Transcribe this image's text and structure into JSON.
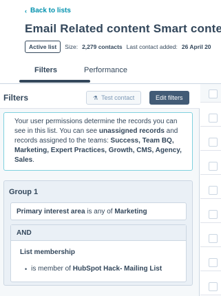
{
  "header": {
    "back_label": "Back to lists",
    "title": "Email Related content Smart content-",
    "badge": "Active list",
    "size_label": "Size:",
    "size_value": "2,279 contacts",
    "last_added_label": "Last contact added:",
    "last_added_value": "26 April 20"
  },
  "tabs": [
    {
      "label": "Filters",
      "active": true
    },
    {
      "label": "Performance",
      "active": false
    }
  ],
  "filters_panel": {
    "title": "Filters",
    "test_contact_label": "Test contact",
    "edit_filters_label": "Edit filters",
    "notice": {
      "text_1": "Your user permissions determine the records you can see in this list. You can see ",
      "bold_1": "unassigned records",
      "text_2": " and records assigned to the teams: ",
      "teams": "Success, Team BQ, Marketing, Expert Practices, Growth, CMS, Agency, Sales",
      "text_3": "."
    },
    "group": {
      "title": "Group 1",
      "condition_property": "Primary interest area",
      "condition_operator": " is any of ",
      "condition_value": "Marketing",
      "and_label": "AND",
      "and_title": "List membership",
      "and_item_prefix": "is member of ",
      "and_item_value": "HubSpot Hack- Mailing List"
    }
  },
  "icons": {
    "back": "chevron-left-icon",
    "test_contact": "flask-icon"
  },
  "colors": {
    "link": "#0091ae",
    "primary_button": "#425b76",
    "notice_border": "#7fd1de"
  }
}
